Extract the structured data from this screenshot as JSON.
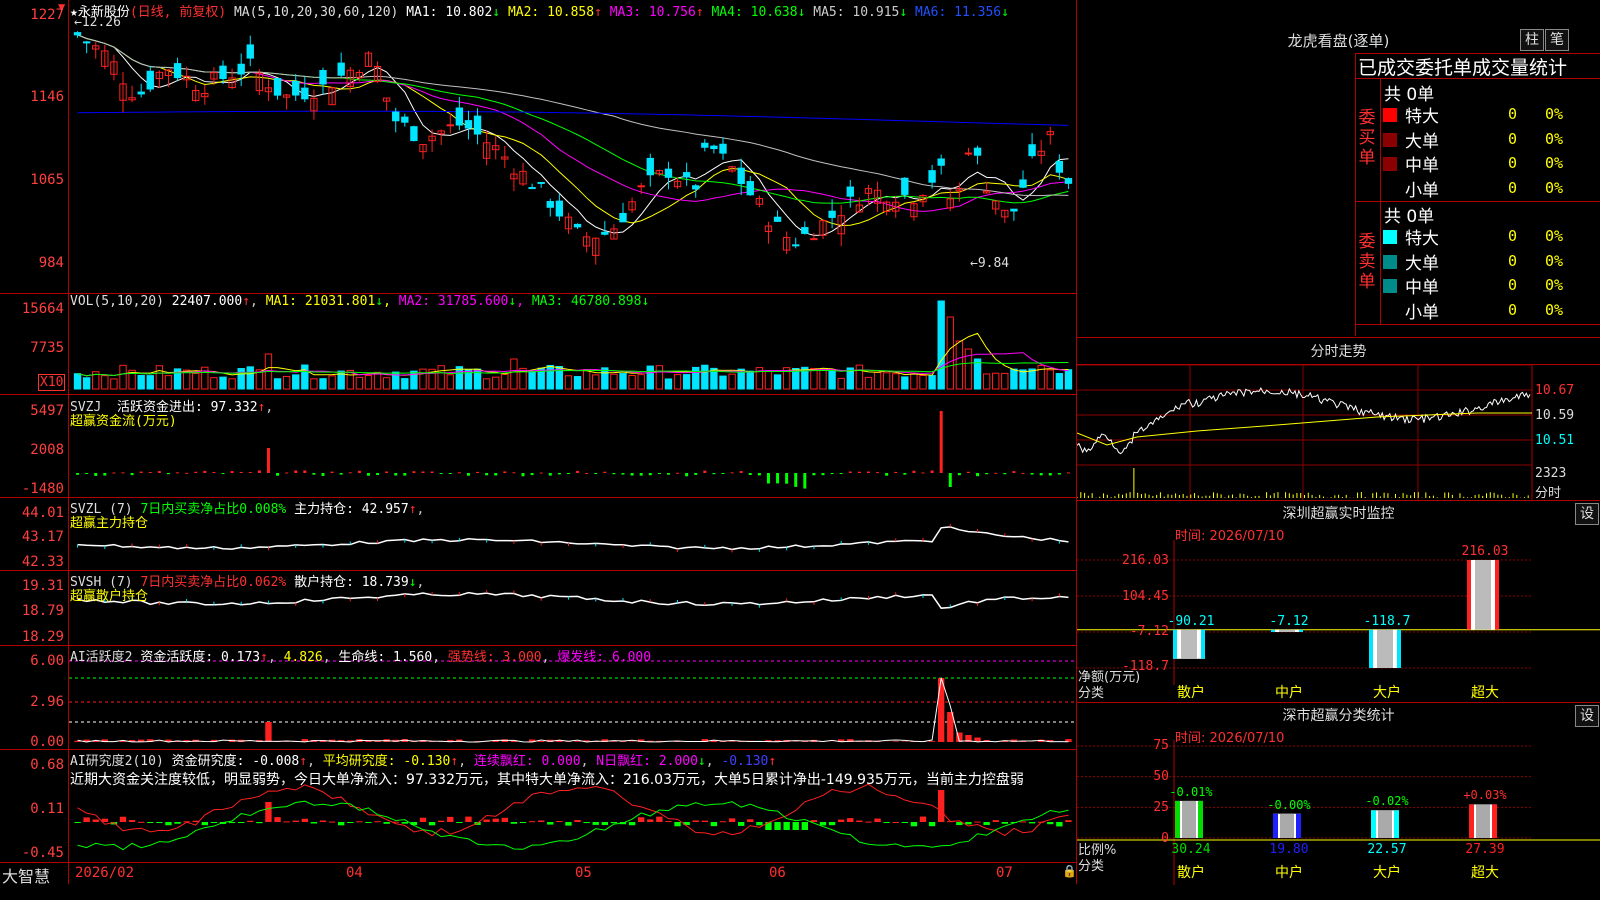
{
  "main": {
    "star": "★",
    "stock_name": "永新股份",
    "period": "(日线, 前复权)",
    "ma_params": "MA(5,10,20,30,60,120)",
    "ma": [
      {
        "label": "MA1:",
        "value": "10.802",
        "arrow": "↓",
        "color": "#ffffff"
      },
      {
        "label": "MA2:",
        "value": "10.858",
        "arrow": "↑",
        "color": "#ffff00"
      },
      {
        "label": "MA3:",
        "value": "10.756",
        "arrow": "↑",
        "color": "#ff00ff"
      },
      {
        "label": "MA4:",
        "value": "10.638",
        "arrow": "↓",
        "color": "#00ff00"
      },
      {
        "label": "MA5:",
        "value": "10.915",
        "arrow": "↓",
        "color": "#c0c0c0"
      },
      {
        "label": "MA6:",
        "value": "11.356",
        "arrow": "↓",
        "color": "#0000ff"
      }
    ],
    "y_labels": [
      "1227",
      "1146",
      "1065",
      "984"
    ],
    "high_mark": "←12.26",
    "low_mark": "←9.84",
    "price_min": 9.84,
    "price_max": 12.26,
    "colors": {
      "up": "#ff2020",
      "down": "#00e5ff",
      "ma5": "#ffffff",
      "ma10": "#ffff00",
      "ma20": "#ff00ff",
      "ma30": "#00ff00",
      "ma60": "#c0c0c0",
      "ma120": "#0000ff"
    }
  },
  "vol": {
    "title": "VOL(5,10,20)",
    "value": "22407.000",
    "value_arrow": "↑",
    "ma": [
      {
        "label": "MA1:",
        "value": "21031.801",
        "arrow": "↓",
        "color": "#ffff00"
      },
      {
        "label": "MA2:",
        "value": "31785.600",
        "arrow": "↓",
        "color": "#ff00ff"
      },
      {
        "label": "MA3:",
        "value": "46780.898",
        "arrow": "↓",
        "color": "#00ff00"
      }
    ],
    "y_labels": [
      "15664",
      "7735"
    ],
    "unit": "X10"
  },
  "svzj": {
    "title": "SVZJ",
    "label": "活跃资金进出:",
    "value": "97.332",
    "arrow": "↑",
    "subtitle": "超赢资金流(万元)",
    "y_labels": [
      "5497",
      "2008",
      "-1480"
    ]
  },
  "svzl": {
    "title": "SVZL (7)",
    "label": "7日内买卖净占比0.008%",
    "label2": "主力持仓:",
    "value": "42.957",
    "arrow": "↑",
    "subtitle": "超赢主力持仓",
    "y_labels": [
      "44.01",
      "43.17",
      "42.33"
    ]
  },
  "svsh": {
    "title": "SVSH (7)",
    "label": "7日内买卖净占比0.062%",
    "label2": "散户持仓:",
    "value": "18.739",
    "arrow": "↓",
    "subtitle": "超赢散户持仓",
    "y_labels": [
      "19.31",
      "18.79",
      "18.29"
    ]
  },
  "ai1": {
    "title": "AI活跃度2",
    "label": "资金活跃度:",
    "value": "0.173",
    "arrow": "↑",
    "value2": "4.826",
    "label3": "生命线:",
    "value3": "1.560",
    "strong": "强势线: 3.000",
    "burst": "爆发线: 6.000",
    "y_labels": [
      "6.00",
      "2.96",
      "0.00"
    ]
  },
  "ai2": {
    "title": "AI研究度2(10)",
    "label": "资金研究度:",
    "value": "-0.008",
    "arrow": "↑",
    "avg": "平均研究度: -0.130",
    "avg_arrow": "↑",
    "red1": "连续飘红: 0.000",
    "red2": "N日飘红: 2.000",
    "red2_arrow": "↓",
    "blue": "-0.130",
    "blue_arrow": "↑",
    "comment": "近期大资金关注度较低，明显弱势，今日大单净流入：97.332万元，其中特大单净流入：216.03万元，大单5日累计净出-149.935万元，当前主力控盘弱",
    "y_labels": [
      "0.68",
      "0.11",
      "-0.45"
    ]
  },
  "xaxis": {
    "brand": "大智慧",
    "months": [
      "2026/02",
      "04",
      "05",
      "06",
      "07"
    ]
  },
  "dragon": {
    "title": "龙虎看盘(逐单)",
    "tab1": "柱",
    "tab2": "笔",
    "header": "已成交委托单成交量统计",
    "buy_title": "委买单",
    "sell_title": "委卖单",
    "buy_total": "共 0单",
    "sell_total": "共 0单",
    "rows": [
      "特大",
      "大单",
      "中单",
      "小单"
    ],
    "count": "0",
    "pct": "0%"
  },
  "intraday": {
    "title": "分时走势",
    "y_labels": [
      "10.67",
      "10.59",
      "10.51"
    ],
    "vol_label": "2323",
    "vol_unit": "分时"
  },
  "monitor": {
    "title": "深圳超赢实时监控",
    "set": "设",
    "time": "时间: 2026/07/10",
    "y_labels": [
      "216.03",
      "104.45",
      "-7.12",
      "-118.7"
    ],
    "axis_label": "净额(万元)",
    "axis_label2": "分类",
    "bars": [
      {
        "name": "散户",
        "value": "-90.21",
        "num": -90.21
      },
      {
        "name": "中户",
        "value": "-7.12",
        "num": -7.12
      },
      {
        "name": "大户",
        "value": "-118.7",
        "num": -118.7
      },
      {
        "name": "超大",
        "value": "216.03",
        "num": 216.03
      }
    ]
  },
  "classify": {
    "title": "深市超赢分类统计",
    "set": "设",
    "time": "时间: 2026/07/10",
    "y_labels": [
      "75",
      "50",
      "25",
      "0"
    ],
    "axis_label": "比例%",
    "axis_label2": "分类",
    "bars": [
      {
        "name": "散户",
        "change": "-0.01%",
        "value": "30.24",
        "color": "#00dd00"
      },
      {
        "name": "中户",
        "change": "-0.00%",
        "value": "19.80",
        "color": "#2020ff"
      },
      {
        "name": "大户",
        "change": "-0.02%",
        "value": "22.57",
        "color": "#00ffff"
      },
      {
        "name": "超大",
        "change": "+0.03%",
        "value": "27.39",
        "color": "#ff2020"
      }
    ]
  }
}
